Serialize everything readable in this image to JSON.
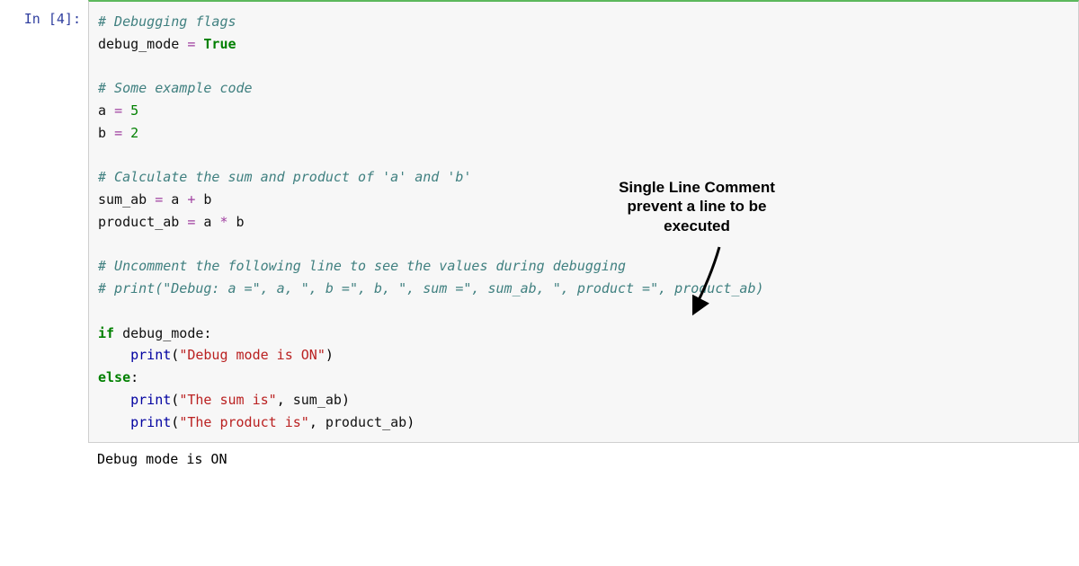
{
  "prompt": {
    "label": "In [4]:"
  },
  "code": {
    "l1_comment": "# Debugging flags",
    "l2_var": "debug_mode",
    "l2_val": "True",
    "l4_comment": "# Some example code",
    "l5_var": "a",
    "l5_val": "5",
    "l6_var": "b",
    "l6_val": "2",
    "l8_comment": "# Calculate the sum and product of 'a' and 'b'",
    "l9_var": "sum_ab",
    "l9_a": "a",
    "l9_b": "b",
    "l10_var": "product_ab",
    "l10_a": "a",
    "l10_b": "b",
    "l12_comment": "# Uncomment the following line to see the values during debugging",
    "l13_comment": "# print(\"Debug: a =\", a, \", b =\", b, \", sum =\", sum_ab, \", product =\", product_ab)",
    "l15_if": "if",
    "l15_cond": "debug_mode",
    "l16_print": "print",
    "l16_str": "\"Debug mode is ON\"",
    "l17_else": "else",
    "l18_print": "print",
    "l18_str": "\"The sum is\"",
    "l18_arg": "sum_ab",
    "l19_print": "print",
    "l19_str": "\"The product is\"",
    "l19_arg": "product_ab"
  },
  "output": {
    "text": "Debug mode is ON"
  },
  "annotation": {
    "line1": "Single Line Comment",
    "line2": "prevent a line to be",
    "line3": "executed"
  }
}
